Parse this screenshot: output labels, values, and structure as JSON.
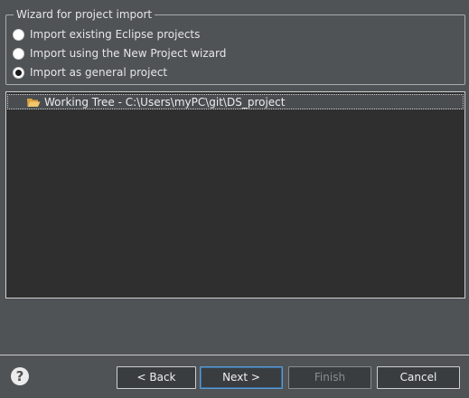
{
  "group": {
    "legend": "Wizard for project import",
    "options": [
      {
        "label": "Import existing Eclipse projects",
        "checked": false
      },
      {
        "label": "Import using the New Project wizard",
        "checked": false
      },
      {
        "label": "Import as general project",
        "checked": true
      }
    ]
  },
  "tree": {
    "items": [
      {
        "label": "Working Tree - C:\\Users\\myPC\\git\\DS_project",
        "icon": "open-folder-icon"
      }
    ]
  },
  "footer": {
    "help_icon": "help-icon",
    "back_label": "< Back",
    "next_label": "Next >",
    "finish_label": "Finish",
    "cancel_label": "Cancel"
  },
  "colors": {
    "background": "#4f5356",
    "tree_background": "#2f2f2f",
    "selected_row": "#4a4d50",
    "default_button_border": "#5b9bd5"
  }
}
